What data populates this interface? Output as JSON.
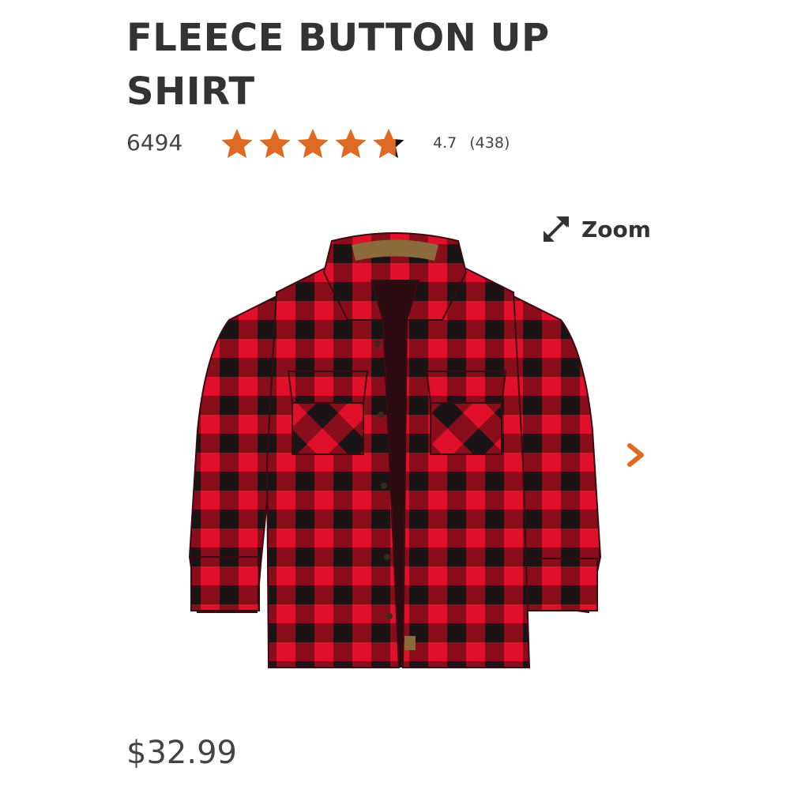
{
  "product": {
    "title": "FLEECE BUTTON UP SHIRT",
    "item_number": "6494",
    "rating": 4.7,
    "rating_value_text": "4.7",
    "review_count_text": "(438)",
    "price": "$32.99"
  },
  "gallery": {
    "zoom_label": "Zoom",
    "zoom_icon": "expand-arrows-icon",
    "next_icon": "chevron-right-icon"
  },
  "colors": {
    "accent": "#e06a22",
    "plaid_red": "#e0102a",
    "plaid_dark": "#1a1416",
    "text": "#333333"
  }
}
